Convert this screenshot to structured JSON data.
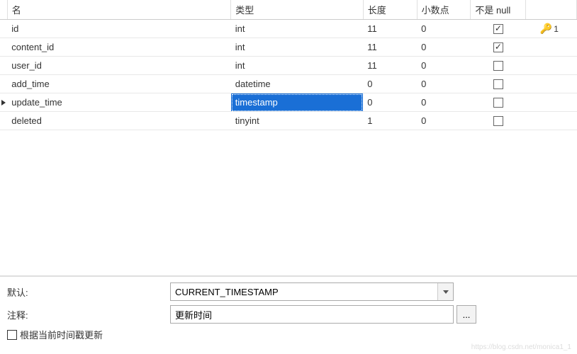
{
  "headers": {
    "name": "名",
    "type": "类型",
    "length": "长度",
    "decimal": "小数点",
    "notnull": "不是 null"
  },
  "rows": [
    {
      "name": "id",
      "type": "int",
      "length": "11",
      "decimal": "0",
      "notnull": true,
      "key": "1",
      "active": false
    },
    {
      "name": "content_id",
      "type": "int",
      "length": "11",
      "decimal": "0",
      "notnull": true,
      "key": "",
      "active": false
    },
    {
      "name": "user_id",
      "type": "int",
      "length": "11",
      "decimal": "0",
      "notnull": false,
      "key": "",
      "active": false
    },
    {
      "name": "add_time",
      "type": "datetime",
      "length": "0",
      "decimal": "0",
      "notnull": false,
      "key": "",
      "active": false
    },
    {
      "name": "update_time",
      "type": "timestamp",
      "length": "0",
      "decimal": "0",
      "notnull": false,
      "key": "",
      "active": true
    },
    {
      "name": "deleted",
      "type": "tinyint",
      "length": "1",
      "decimal": "0",
      "notnull": false,
      "key": "",
      "active": false
    }
  ],
  "form": {
    "default_label": "默认:",
    "default_value": "CURRENT_TIMESTAMP",
    "comment_label": "注释:",
    "comment_value": "更新时间",
    "autoupdate_label": "根据当前时间戳更新",
    "autoupdate_checked": false
  },
  "watermark": "https://blog.csdn.net/monica1_1"
}
